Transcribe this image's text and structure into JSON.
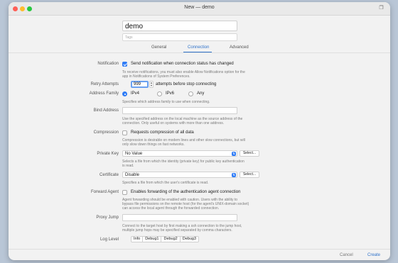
{
  "window": {
    "title": "New — demo"
  },
  "name": {
    "value": "demo",
    "tags_placeholder": "Tags"
  },
  "tabs": [
    {
      "label": "General"
    },
    {
      "label": "Connection"
    },
    {
      "label": "Advanced"
    }
  ],
  "notification": {
    "label": "Notification",
    "checkbox_text": "Send notification when connection status has changed",
    "checked": true,
    "desc1": "To receive notifications, you must also enable Allow Notifications option for the",
    "desc2": "app in Notifications of System Preferences."
  },
  "retry": {
    "label": "Retry Attempts",
    "value": "999",
    "suffix": "attempts before stop connecting"
  },
  "address_family": {
    "label": "Address Family",
    "options": [
      "IPv4",
      "IPv6",
      "Any"
    ],
    "selected": "IPv4",
    "desc": "Specifies which address family to use when connecting."
  },
  "bind_address": {
    "label": "Bind Address",
    "value": "",
    "desc1": "Use the specified address on the local machine as the source address of the",
    "desc2": "connection. Only useful on systems with more than one address."
  },
  "compression": {
    "label": "Compression",
    "checkbox_text": "Requests compression of all data",
    "checked": false,
    "desc1": "Compression is desirable on modem lines and other slow connections, but will",
    "desc2": "only slow down things on fast networks."
  },
  "private_key": {
    "label": "Private Key",
    "value": "No Value",
    "button": "Select...",
    "desc1": "Selects a file from which the identity (private key) for public key authentication",
    "desc2": "is read."
  },
  "certificate": {
    "label": "Certificate",
    "value": "Disable",
    "button": "Select...",
    "desc": "Specifies a file from which the user's certificate is read."
  },
  "forward_agent": {
    "label": "Forward Agent",
    "checkbox_text": "Enables forwarding of the authentication agent connection",
    "checked": false,
    "desc1": "Agent forwarding should be enabled with caution. Users with the ability to",
    "desc2": "bypass file permissions on the remote host (for the agent's UNIX-domain socket)",
    "desc3": "can access the local agent through the forwarded connection."
  },
  "proxy_jump": {
    "label": "Proxy Jump",
    "value": "",
    "desc1": "Connect to the target host by first making a ssh connection to the jump host,",
    "desc2": "multiple jump hops may be specified separated by comma characters."
  },
  "log_level": {
    "label": "Log Level",
    "options": [
      "Info",
      "Debug1",
      "Debug2",
      "Debug3"
    ]
  },
  "footer": {
    "cancel": "Cancel",
    "create": "Create"
  },
  "colors": {
    "accent": "#2f72c9",
    "checkbox": "#2f7cf6"
  }
}
